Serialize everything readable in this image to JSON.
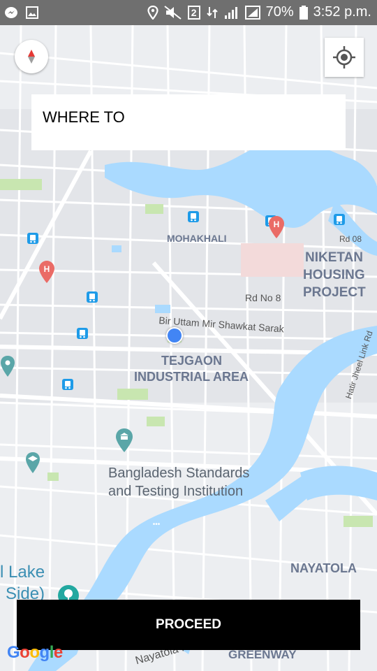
{
  "status": {
    "battery": "70%",
    "time": "3:52 p.m.",
    "sim": "2"
  },
  "search": {
    "label": "WHERE TO"
  },
  "map": {
    "labels": {
      "mohakhali": "MOHAKHALI",
      "rd08": "Rd 08",
      "niketan_1": "NIKETAN",
      "niketan_2": "HOUSING",
      "niketan_3": "PROJECT",
      "rdno8": "Rd No 8",
      "bir_uttam": "Bir Uttam Mir Shawkat Sarak",
      "tejgaon_1": "TEJGAON",
      "tejgaon_2": "INDUSTRIAL AREA",
      "bsti_1": "Bangladesh Standards",
      "bsti_2": "and Testing Institution",
      "lake_1": "l Lake",
      "lake_2": "Side)",
      "nayatola": "NAYATOLA",
      "link_rd": "Hatir Jheel Link Rd",
      "greenway": "GREENWAY",
      "nayatola_rd": "Nayatola R"
    },
    "attribution": "Google"
  },
  "actions": {
    "proceed": "PROCEED"
  },
  "colors": {
    "water": "#aadaff",
    "park": "#c8e6b0",
    "road": "#ffffff",
    "block": "#eceef1",
    "hospital": "#ea6b66",
    "bus": "#1e9be8",
    "poi": "#5aa6a8",
    "location_dot": "#4285f4"
  }
}
